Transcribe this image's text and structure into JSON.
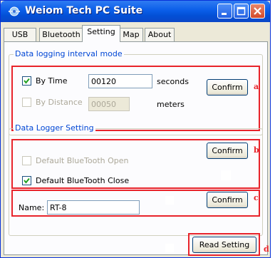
{
  "window": {
    "title": "Weiom Tech PC Suite"
  },
  "tabs": [
    {
      "label": "USB",
      "active": false
    },
    {
      "label": "Bluetooth",
      "active": false
    },
    {
      "label": "Setting",
      "active": true
    },
    {
      "label": "Map",
      "active": false
    },
    {
      "label": "About",
      "active": false
    }
  ],
  "logging": {
    "group_title": "Data logging interval mode",
    "by_time": {
      "label": "By Time",
      "checked": true,
      "value": "00120",
      "unit": "seconds"
    },
    "by_distance": {
      "label": "By Distance",
      "checked": false,
      "value": "00050",
      "unit": "meters"
    },
    "confirm_label": "Confirm"
  },
  "logger": {
    "group_title": "Data Logger Setting",
    "bt_open": {
      "label": "Default BlueTooth Open",
      "checked": false
    },
    "bt_close": {
      "label": "Default BlueTooth Close",
      "checked": true
    },
    "confirm_label": "Confirm"
  },
  "name": {
    "label": "Name:",
    "value": "RT-8",
    "confirm_label": "Confirm"
  },
  "read_setting_label": "Read Setting",
  "annotations": {
    "a": "a",
    "b": "b",
    "c": "c",
    "d": "d"
  },
  "colors": {
    "accent_red": "#e8232a",
    "group_title": "#0046d5",
    "titlebar": "#0a5ee8"
  }
}
